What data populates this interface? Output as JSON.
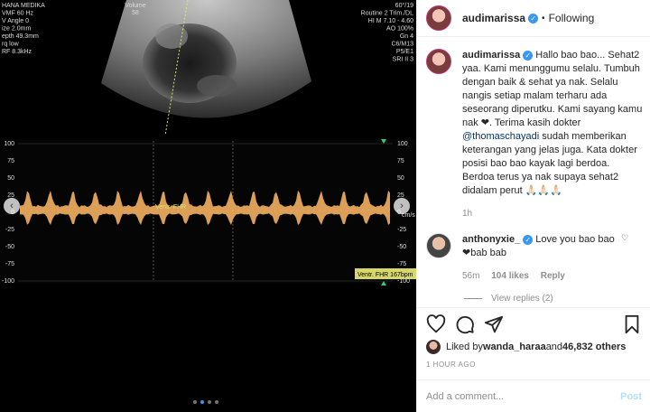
{
  "colors": {
    "accent": "#3897f0",
    "waveform": "#e8a85c",
    "meta": "#8e8e8e",
    "mention": "#00376b"
  },
  "media": {
    "overlay_left": [
      "HANA MEDIKA",
      "VMF 60 Hz",
      "V Angle 0",
      "ize 2.0mm",
      "epth 49.3mm",
      "rq low",
      "RF 8.3kHz"
    ],
    "overlay_top_center": [
      "Volume",
      "58"
    ],
    "overlay_right": [
      "60°/19",
      "Routine 2 Trim./DL",
      "HI M 7.10 - 4.60",
      "AO 100%",
      "Gn 4",
      "C6/M13",
      "P5/E1",
      "SRI II 3"
    ],
    "axis_ticks": [
      "100",
      "75",
      "50",
      "25",
      "0",
      "-25",
      "-50",
      "-75",
      "-100"
    ],
    "axis_unit": "cm/s",
    "marker_label": "Ventr. FHR",
    "readout_label": "Ventr. FHR 167bpm",
    "carousel": {
      "count": 4,
      "active": 1
    },
    "prev_icon": "chevron-left-icon",
    "next_icon": "chevron-right-icon"
  },
  "header": {
    "username": "audimarissa",
    "separator": "•",
    "follow_label": "Following"
  },
  "caption": {
    "username": "audimarissa",
    "text_before": "Hallo bao bao... Sehat2 yaa. Kami menunggumu selalu. Tumbuh dengan baik & sehat ya nak. Selalu nangis setiap malam terharu ada seseorang diperutku. Kami sayang kamu nak ❤. Terima kasih dokter ",
    "mention": "@thomaschayadi",
    "text_after": " sudah memberikan keterangan yang jelas juga. Kata dokter posisi bao bao kayak lagi berdoa. Berdoa terus ya nak supaya sehat2 didalam perut 🙏🏻🙏🏻🙏🏻",
    "time": "1h"
  },
  "comment": {
    "username": "anthonyxie_",
    "text": "Love you bao bao ❤bab bab",
    "time": "56m",
    "likes": "104 likes",
    "reply_label": "Reply"
  },
  "view_replies": "View replies (2)",
  "likes": {
    "prefix": "Liked by ",
    "user": "wanda_haraa",
    "middle": " and ",
    "count": "46,832 others"
  },
  "timestamp": "1 HOUR AGO",
  "add_comment": {
    "placeholder": "Add a comment...",
    "post_label": "Post"
  }
}
